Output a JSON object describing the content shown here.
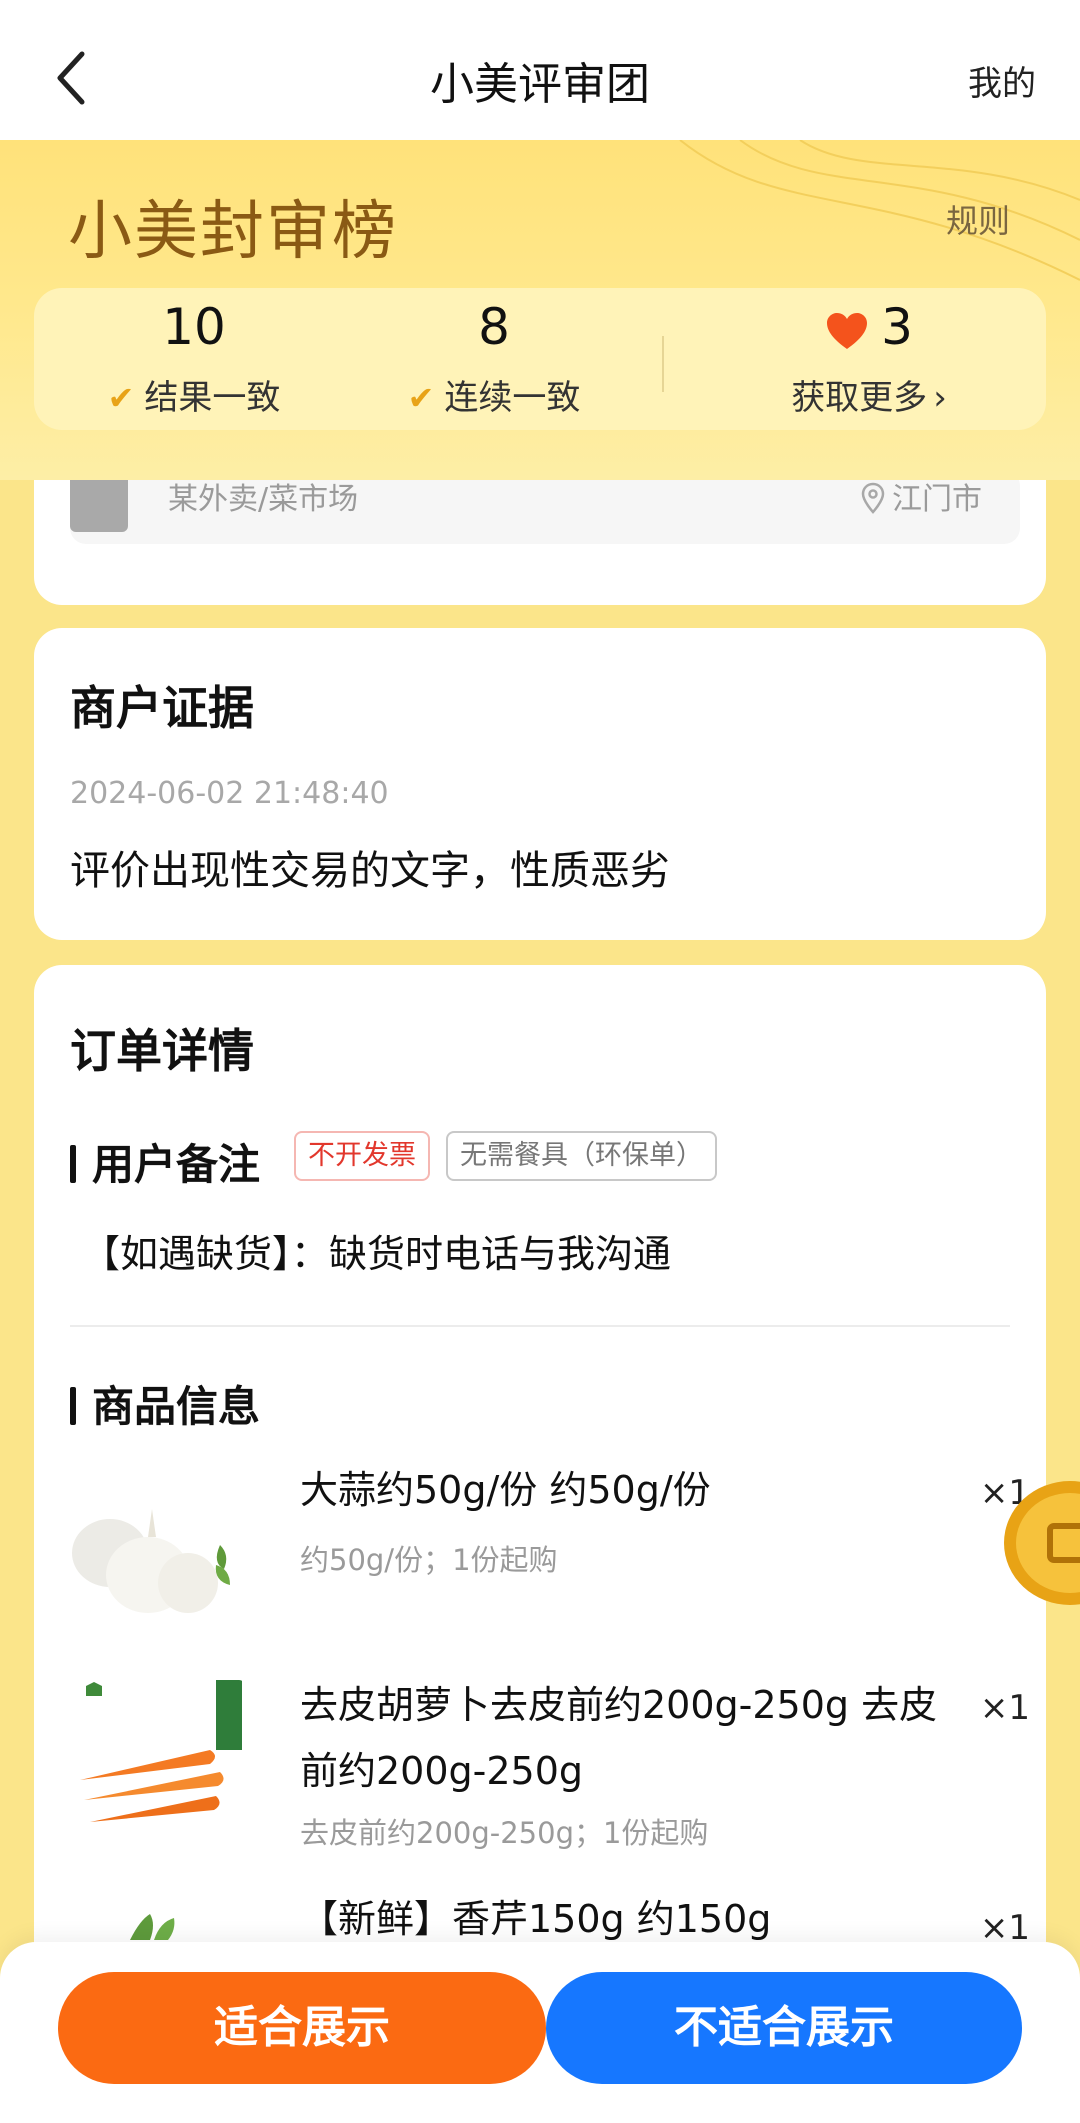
{
  "nav": {
    "title": "小美评审团",
    "mine": "我的",
    "back_icon": "chevron-left-icon"
  },
  "banner": {
    "brand": "小美封审榜",
    "rules": "规则",
    "stats": [
      {
        "value": "10",
        "label": "结果一致",
        "icon": "check-icon"
      },
      {
        "value": "8",
        "label": "连续一致",
        "icon": "double-check-icon"
      },
      {
        "value": "3",
        "label": "获取更多",
        "icon": "heart-icon",
        "suffix": "›"
      }
    ]
  },
  "store": {
    "name": "某外卖/菜市场",
    "location": "江门市"
  },
  "evidence": {
    "title": "商户证据",
    "time": "2024-06-02 21:48:40",
    "text": "评价出现性交易的文字，性质恶劣"
  },
  "order": {
    "title": "订单详情",
    "remark_title": "用户备注",
    "tags": [
      "不开发票",
      "无需餐具（环保单）"
    ],
    "remark_text": "【如遇缺货】：缺货时电话与我沟通",
    "goods_title": "商品信息",
    "products": [
      {
        "name": "大蒜约50g/份 约50g/份",
        "spec": "约50g/份；1份起购",
        "qty": "×1",
        "image": "garlic"
      },
      {
        "name": "去皮胡萝卜去皮前约200g-250g 去皮前约200g-250g",
        "spec": "去皮前约200g-250g；1份起购",
        "qty": "×1",
        "image": "carrot"
      },
      {
        "name": "【新鲜】香芹150g 约150g",
        "spec": "",
        "qty": "×1",
        "image": "celery"
      }
    ]
  },
  "actions": {
    "suitable": "适合展示",
    "unsuitable": "不适合展示"
  },
  "colors": {
    "accent_orange": "#fb6a12",
    "accent_blue": "#1677ff",
    "banner_yellow": "#ffe27a",
    "tag_red": "#e2372c"
  }
}
